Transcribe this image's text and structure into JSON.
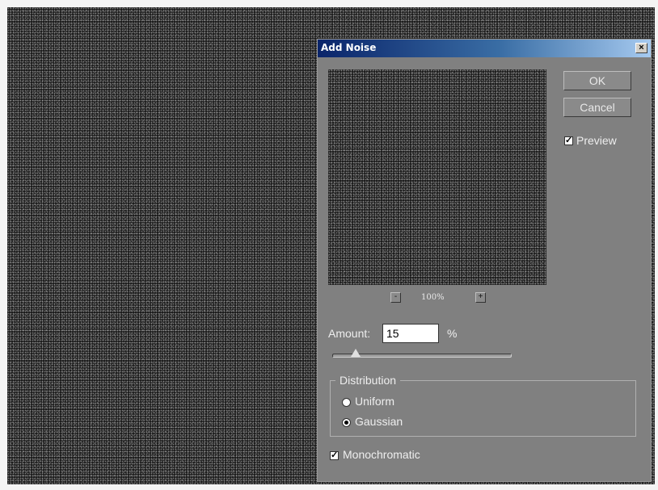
{
  "dialog": {
    "title": "Add Noise",
    "close_glyph": "×",
    "ok_label": "OK",
    "cancel_label": "Cancel",
    "preview_checked": true,
    "preview_label": "Preview",
    "zoom_out_glyph": "-",
    "zoom_in_glyph": "+",
    "zoom_level": "100%",
    "amount_label": "Amount:",
    "amount_value": "15",
    "amount_unit": "%",
    "amount_slider_fraction": 0.13,
    "distribution_label": "Distribution",
    "distribution_options": [
      {
        "label": "Uniform",
        "selected": false
      },
      {
        "label": "Gaussian",
        "selected": true
      }
    ],
    "monochromatic_checked": true,
    "monochromatic_label": "Monochromatic",
    "check_glyph": "✓"
  },
  "colors": {
    "dialog_bg": "#808080",
    "title_gradient_start": "#0a246a",
    "title_gradient_end": "#a6caf0",
    "noise_bg": "#1b1b1b"
  }
}
